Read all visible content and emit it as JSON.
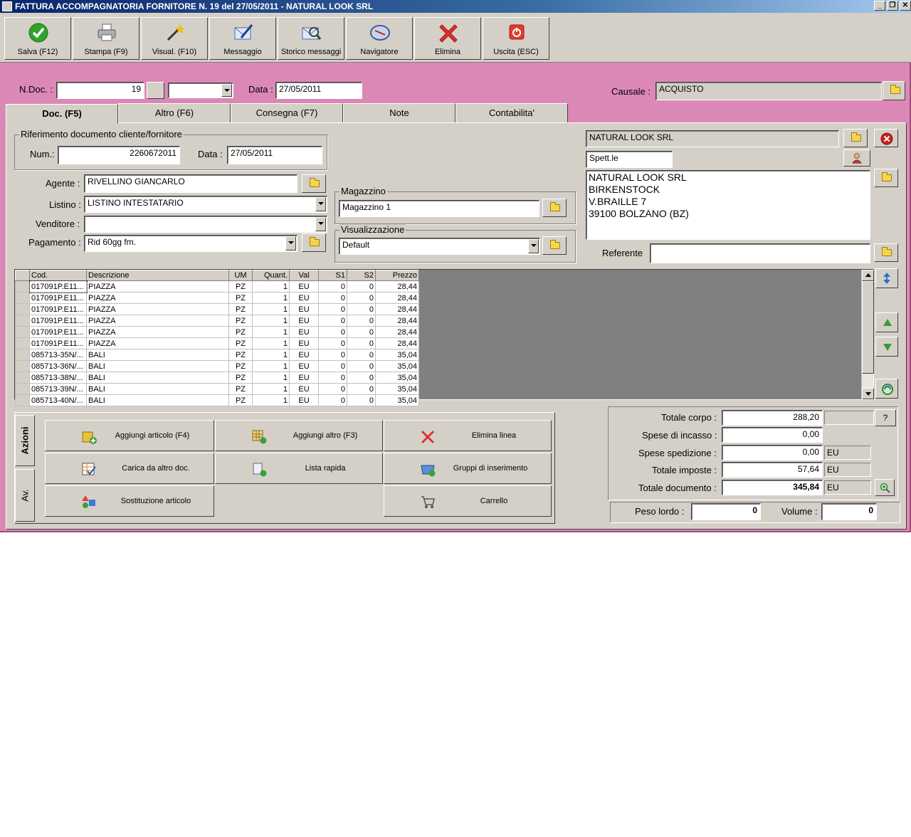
{
  "window": {
    "title": "FATTURA ACCOMPAGNATORIA FORNITORE N. 19  del 27/05/2011 - NATURAL LOOK SRL"
  },
  "toolbar": {
    "save": "Salva (F12)",
    "print": "Stampa (F9)",
    "view": "Visual. (F10)",
    "message": "Messaggio",
    "history": "Storico messaggi",
    "navigator": "Navigatore",
    "delete": "Elimina",
    "exit": "Uscita (ESC)"
  },
  "header": {
    "ndoc_label": "N.Doc. :",
    "ndoc_value": "19",
    "date_label": "Data :",
    "date_value": "27/05/2011",
    "causale_label": "Causale :",
    "causale_value": "ACQUISTO"
  },
  "tabs": [
    "Doc. (F5)",
    "Altro (F6)",
    "Consegna (F7)",
    "Note",
    "Contabilita'"
  ],
  "reference": {
    "group_title": "Riferimento documento cliente/fornitore",
    "num_label": "Num.:",
    "num_value": "2260672011",
    "date_label": "Data :",
    "date_value": "27/05/2011"
  },
  "fields": {
    "agent_label": "Agente :",
    "agent_value": "RIVELLINO GIANCARLO",
    "listino_label": "Listino :",
    "listino_value": "LISTINO INTESTATARIO",
    "seller_label": "Venditore :",
    "seller_value": "",
    "payment_label": "Pagamento :",
    "payment_value": "Rid 60gg  fm."
  },
  "warehouse": {
    "group_title": "Magazzino",
    "value": "Magazzino 1"
  },
  "display": {
    "group_title": "Visualizzazione",
    "value": "Default"
  },
  "supplier": {
    "name": "NATURAL LOOK SRL",
    "salutation": "Spett.le",
    "address_lines": [
      "NATURAL LOOK SRL",
      "BIRKENSTOCK",
      "V.BRAILLE 7",
      "39100 BOLZANO (BZ)"
    ],
    "referent_label": "Referente",
    "referent_value": ""
  },
  "grid": {
    "columns": [
      "",
      "Cod.",
      "Descrizione",
      "UM",
      "Quant.",
      "Val",
      "S1",
      "S2",
      "Prezzo"
    ],
    "rows": [
      [
        "",
        "017091P.E11...",
        "PIAZZA",
        "PZ",
        "1",
        "EU",
        "0",
        "0",
        "28,44"
      ],
      [
        "",
        "017091P.E11...",
        "PIAZZA",
        "PZ",
        "1",
        "EU",
        "0",
        "0",
        "28,44"
      ],
      [
        "",
        "017091P.E11...",
        "PIAZZA",
        "PZ",
        "1",
        "EU",
        "0",
        "0",
        "28,44"
      ],
      [
        "",
        "017091P.E11...",
        "PIAZZA",
        "PZ",
        "1",
        "EU",
        "0",
        "0",
        "28,44"
      ],
      [
        "",
        "017091P.E11...",
        "PIAZZA",
        "PZ",
        "1",
        "EU",
        "0",
        "0",
        "28,44"
      ],
      [
        "",
        "017091P.E11...",
        "PIAZZA",
        "PZ",
        "1",
        "EU",
        "0",
        "0",
        "28,44"
      ],
      [
        "",
        "085713-35N/...",
        "BALI",
        "PZ",
        "1",
        "EU",
        "0",
        "0",
        "35,04"
      ],
      [
        "",
        "085713-36N/...",
        "BALI",
        "PZ",
        "1",
        "EU",
        "0",
        "0",
        "35,04"
      ],
      [
        "",
        "085713-38N/...",
        "BALI",
        "PZ",
        "1",
        "EU",
        "0",
        "0",
        "35,04"
      ],
      [
        "",
        "085713-39N/...",
        "BALI",
        "PZ",
        "1",
        "EU",
        "0",
        "0",
        "35,04"
      ],
      [
        "",
        "085713-40N/...",
        "BALI",
        "PZ",
        "1",
        "EU",
        "0",
        "0",
        "35,04"
      ]
    ]
  },
  "actions": {
    "tab_actions": "Azioni",
    "tab_av": "Av.",
    "add_item": "Aggiungi articolo (F4)",
    "add_other": "Aggiungi altro (F3)",
    "delete_line": "Elimina linea",
    "load_other": "Carica da altro doc.",
    "quick_list": "Lista rapida",
    "insert_groups": "Gruppi di inserimento",
    "replace_item": "Sostituzione articolo",
    "cart": "Carrello"
  },
  "totals": {
    "body_label": "Totale corpo :",
    "body_value": "288,20",
    "collection_label": "Spese di incasso :",
    "collection_value": "0,00",
    "shipping_label": "Spese spedizione :",
    "shipping_value": "0,00",
    "shipping_currency": "EU",
    "taxes_label": "Totale imposte :",
    "taxes_value": "57,64",
    "taxes_currency": "EU",
    "doc_label": "Totale documento :",
    "doc_value": "345,84",
    "doc_currency": "EU",
    "help": "?"
  },
  "weights": {
    "gross_label": "Peso lordo :",
    "gross_value": "0",
    "volume_label": "Volume :",
    "volume_value": "0"
  },
  "colors": {
    "background": "#dc88b7",
    "face": "#d4d0c8",
    "title_bar": "#0a246a"
  }
}
